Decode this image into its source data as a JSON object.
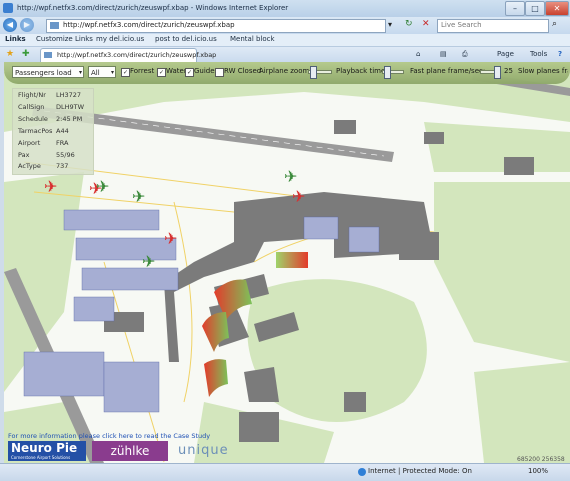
{
  "window": {
    "title": "http://wpf.netfx3.com/direct/zurich/zeuswpf.xbap - Windows Internet Explorer",
    "minimize": "–",
    "maximize": "□",
    "close": "✕"
  },
  "address_bar": {
    "url": "http://wpf.netfx3.com/direct/zurich/zeuswpf.xbap",
    "search_placeholder": "Live Search",
    "refresh": "↻",
    "stop": "✕",
    "go": "⌕"
  },
  "links_bar": {
    "label": "Links",
    "items": [
      "Customize Links",
      "my del.icio.us",
      "post to del.icio.us",
      "Mental block"
    ]
  },
  "tab": {
    "label": "http://wpf.netfx3.com/direct/zurich/zeuswpf.xbap"
  },
  "toolbar": {
    "home": "⌂",
    "feeds": "▤",
    "print": "⎙",
    "page": "Page",
    "tools": "Tools",
    "help": "?"
  },
  "controls": {
    "view_select": "Passengers load",
    "filter_select": "All",
    "checkboxes": [
      {
        "label": "Forrest",
        "checked": true
      },
      {
        "label": "Water",
        "checked": true
      },
      {
        "label": "Guides",
        "checked": true
      },
      {
        "label": "RW Closed",
        "checked": false
      }
    ],
    "airplane_zoom_label": "Airplane zoom:",
    "playback_label": "Playback time:",
    "fast_frame_label": "Fast plane frame/sec:",
    "fast_frame_value": "25",
    "slow_frame_label": "Slow planes fram"
  },
  "flight_info": [
    {
      "key": "Flight/Nr",
      "value": "LH3727"
    },
    {
      "key": "CallSign",
      "value": "DLH9TW"
    },
    {
      "key": "Schedule",
      "value": "2:45 PM"
    },
    {
      "key": "TarmacPos",
      "value": "A44"
    },
    {
      "key": "Airport",
      "value": "FRA"
    },
    {
      "key": "Pax",
      "value": "55/96"
    },
    {
      "key": "AcType",
      "value": "737"
    }
  ],
  "footer": {
    "case_study_link": "For more information please click here to read the Case Study",
    "logos": [
      "Neuro Pie",
      "zühlke",
      "unique"
    ],
    "neuro_tagline": "Cornerstone Airport Solutions",
    "coords": "685200 256358"
  },
  "status_bar": {
    "zone": "Internet | Protected Mode: On",
    "zoom": "100%"
  },
  "colors": {
    "grass": "#cfe3b8",
    "building": "#7a7a7a",
    "gate": "#9aa3c8",
    "plane_red": "#d83030",
    "plane_green": "#3b8a3b"
  }
}
